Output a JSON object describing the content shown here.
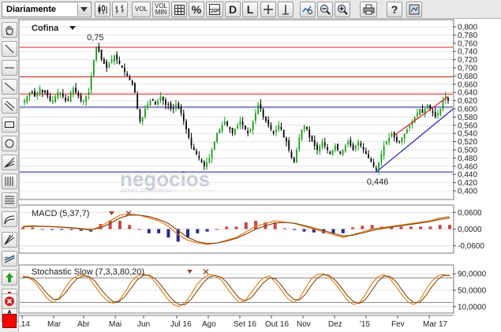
{
  "toolbar": {
    "period": "Diariamente",
    "vol_label": "VOL",
    "volmin_top": "VOL",
    "volmin_bottom": "MIN",
    "percent_label": "%",
    "d_label": "D",
    "l_label": "L",
    "help_label": "?"
  },
  "colors": {
    "up_candle": "#1a9a1a",
    "down_candle": "#000000",
    "macd_line": "#e07b1a",
    "hist_up": "#c24a4a",
    "hist_down": "#2a2a8a",
    "stoch_k": "#e07b1a",
    "stoch_d": "#8a4a10",
    "hline_red": "#e02020",
    "hline_blue": "#1a1a9a",
    "trend_blue": "#2020c0",
    "trend_red": "#e02020",
    "color_swatch": "#ff0000"
  },
  "chart_data": [
    {
      "type": "candlestick",
      "title": "Cofina",
      "ylim": [
        0.39,
        0.81
      ],
      "y_ticks": [
        "0,800",
        "0,780",
        "0,760",
        "0,740",
        "0,720",
        "0,700",
        "0,680",
        "0,660",
        "0,640",
        "0,620",
        "0,600",
        "0,580",
        "0,560",
        "0,540",
        "0,520",
        "0,500",
        "0,480",
        "0,460",
        "0,440",
        "0,420",
        "0,400"
      ],
      "x_ticks": [
        ".14",
        "Mar",
        "Abr",
        "Mai",
        "Jun",
        "Jul 16",
        "Ago",
        "Set 16",
        "Out 16",
        "Nov",
        "Dez",
        "'15",
        "Fev",
        "Mar 17"
      ],
      "close": [
        0.62,
        0.63,
        0.64,
        0.64,
        0.63,
        0.64,
        0.65,
        0.64,
        0.64,
        0.63,
        0.62,
        0.62,
        0.63,
        0.64,
        0.64,
        0.63,
        0.62,
        0.62,
        0.64,
        0.65,
        0.64,
        0.63,
        0.62,
        0.62,
        0.63,
        0.64,
        0.68,
        0.72,
        0.75,
        0.74,
        0.72,
        0.71,
        0.7,
        0.71,
        0.72,
        0.73,
        0.72,
        0.71,
        0.7,
        0.69,
        0.68,
        0.67,
        0.66,
        0.64,
        0.6,
        0.57,
        0.58,
        0.6,
        0.61,
        0.62,
        0.62,
        0.61,
        0.62,
        0.63,
        0.62,
        0.61,
        0.61,
        0.6,
        0.6,
        0.61,
        0.6,
        0.59,
        0.57,
        0.55,
        0.53,
        0.51,
        0.5,
        0.49,
        0.48,
        0.47,
        0.46,
        0.47,
        0.48,
        0.5,
        0.52,
        0.54,
        0.55,
        0.56,
        0.57,
        0.56,
        0.55,
        0.54,
        0.55,
        0.56,
        0.57,
        0.56,
        0.55,
        0.54,
        0.55,
        0.57,
        0.59,
        0.61,
        0.6,
        0.58,
        0.57,
        0.56,
        0.55,
        0.54,
        0.55,
        0.56,
        0.55,
        0.53,
        0.52,
        0.5,
        0.48,
        0.47,
        0.5,
        0.53,
        0.55,
        0.56,
        0.55,
        0.53,
        0.52,
        0.51,
        0.5,
        0.51,
        0.52,
        0.51,
        0.5,
        0.49,
        0.5,
        0.51,
        0.5,
        0.49,
        0.5,
        0.51,
        0.52,
        0.51,
        0.5,
        0.51,
        0.52,
        0.51,
        0.5,
        0.49,
        0.48,
        0.47,
        0.46,
        0.45,
        0.47,
        0.49,
        0.51,
        0.52,
        0.53,
        0.54,
        0.53,
        0.52,
        0.52,
        0.53,
        0.54,
        0.55,
        0.56,
        0.57,
        0.58,
        0.59,
        0.6,
        0.59,
        0.6,
        0.61,
        0.6,
        0.59,
        0.58,
        0.59,
        0.6,
        0.62,
        0.63,
        0.62
      ],
      "annotations": [
        {
          "text": "0,75",
          "x": 28,
          "y": 0.76
        },
        {
          "text": "0,446",
          "x": 137,
          "y": 0.446
        }
      ],
      "horizontal_lines": [
        {
          "y": 0.75,
          "color": "red"
        },
        {
          "y": 0.678,
          "color": "red"
        },
        {
          "y": 0.636,
          "color": "red"
        },
        {
          "y": 0.604,
          "color": "blue"
        },
        {
          "y": 0.446,
          "color": "blue"
        }
      ],
      "trendlines": [
        {
          "from": [
            137,
            0.446
          ],
          "to": [
            167,
            0.6
          ],
          "color": "blue"
        },
        {
          "from": [
            144,
            0.535
          ],
          "to": [
            165,
            0.63
          ],
          "color": "red"
        }
      ]
    },
    {
      "type": "line",
      "title": "MACD (5,37,7)",
      "ylim": [
        -0.075,
        0.075
      ],
      "y_ticks": [
        "0,0600",
        "0,0000",
        "-0,0600"
      ],
      "series": [
        {
          "values": [
            0.01,
            0.012,
            0.01,
            0.008,
            0.006,
            0.004,
            0.0,
            -0.004,
            0.01,
            0.03,
            0.05,
            0.055,
            0.05,
            0.04,
            0.03,
            0.01,
            -0.02,
            -0.04,
            -0.05,
            -0.055,
            -0.05,
            -0.04,
            -0.03,
            -0.01,
            0.01,
            0.02,
            0.03,
            0.025,
            0.02,
            0.01,
            0.0,
            -0.01,
            -0.02,
            -0.03,
            -0.02,
            -0.01,
            0.0,
            0.005,
            0.01,
            0.015,
            0.02,
            0.025,
            0.03,
            0.04,
            0.045
          ]
        },
        {
          "values": [
            0.008,
            0.01,
            0.01,
            0.009,
            0.007,
            0.005,
            0.002,
            -0.001,
            0.004,
            0.02,
            0.04,
            0.05,
            0.05,
            0.045,
            0.035,
            0.02,
            -0.005,
            -0.03,
            -0.045,
            -0.052,
            -0.05,
            -0.043,
            -0.033,
            -0.018,
            0.0,
            0.012,
            0.022,
            0.024,
            0.021,
            0.013,
            0.004,
            -0.005,
            -0.015,
            -0.025,
            -0.022,
            -0.014,
            -0.005,
            0.002,
            0.007,
            0.012,
            0.017,
            0.022,
            0.027,
            0.035,
            0.04
          ]
        }
      ]
    },
    {
      "type": "line",
      "title": "Stochastic Slow (7,3,3,80,20)",
      "ylim": [
        0,
        100
      ],
      "y_ticks": [
        "90,0000",
        "50,0000",
        "10,0000"
      ],
      "reference_lines": [
        80,
        20
      ],
      "series": [
        {
          "values": [
            85,
            80,
            70,
            50,
            30,
            20,
            30,
            55,
            75,
            85,
            88,
            80,
            60,
            40,
            25,
            18,
            25,
            45,
            70,
            85,
            90,
            85,
            70,
            50,
            30,
            15,
            10,
            20,
            40,
            65,
            80,
            88,
            85,
            75,
            55,
            35,
            20,
            25,
            45,
            65,
            80,
            85,
            70,
            50,
            30,
            20,
            30,
            55,
            78,
            88,
            90,
            82,
            65,
            45,
            25,
            15,
            20,
            40,
            65,
            82,
            88,
            80,
            60,
            40,
            22,
            15,
            25,
            50,
            72,
            85,
            88,
            85
          ]
        },
        {
          "values": [
            82,
            82,
            75,
            60,
            42,
            28,
            28,
            42,
            62,
            78,
            85,
            84,
            72,
            52,
            35,
            22,
            22,
            35,
            55,
            75,
            86,
            87,
            78,
            62,
            42,
            25,
            15,
            15,
            28,
            48,
            68,
            82,
            86,
            82,
            68,
            48,
            30,
            24,
            32,
            50,
            68,
            80,
            78,
            62,
            42,
            28,
            26,
            40,
            62,
            80,
            88,
            86,
            74,
            56,
            36,
            22,
            18,
            28,
            48,
            70,
            84,
            84,
            72,
            52,
            32,
            20,
            20,
            36,
            58,
            76,
            86,
            86
          ]
        }
      ]
    }
  ],
  "watermark": {
    "brand": "negocios",
    "sub": "JORNAL DE NEGÓCIOS"
  }
}
